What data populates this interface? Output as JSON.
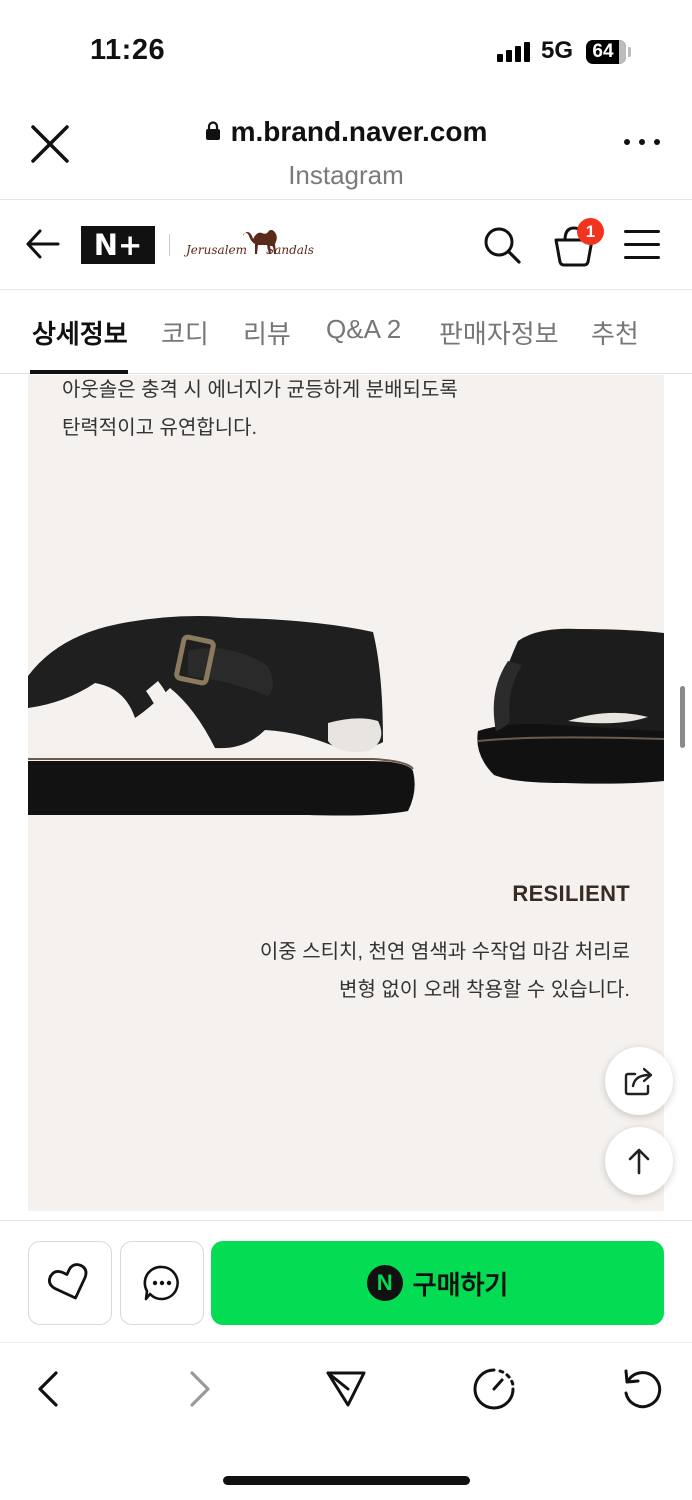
{
  "status_bar": {
    "time": "11:26",
    "network": "5G",
    "battery": "64"
  },
  "browser": {
    "url": "m.brand.naver.com",
    "subtitle": "Instagram",
    "close_icon": "close-icon",
    "more_icon": "more-icon"
  },
  "store_header": {
    "nplus_label": "N+",
    "brand_part1": "Jerusalem",
    "brand_part2": "Sandals",
    "cart_count": "1"
  },
  "tabs": [
    {
      "label": "상세정보",
      "active": true
    },
    {
      "label": "코디",
      "active": false
    },
    {
      "label": "리뷰",
      "active": false
    },
    {
      "label": "Q&A 2",
      "active": false
    },
    {
      "label": "판매자정보",
      "active": false
    },
    {
      "label": "추천",
      "active": false
    }
  ],
  "content": {
    "desc_top_line1": "아웃솔은 충격 시 에너지가 균등하게 분배되도록",
    "desc_top_line2": "탄력적이고 유연합니다.",
    "resilient_title": "RESILIENT",
    "resilient_line1": "이중 스티치, 천연 염색과 수작업 마감 처리로",
    "resilient_line2": "변형 없이 오래 착용할 수 있습니다."
  },
  "purchase": {
    "buy_label": "구매하기",
    "n_badge": "N"
  },
  "colors": {
    "buy_green": "#03dc53",
    "badge_red": "#f0341f",
    "content_bg": "#f4f1ee"
  }
}
